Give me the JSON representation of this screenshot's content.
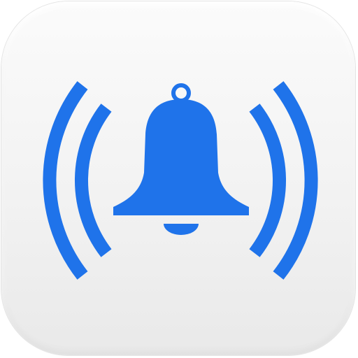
{
  "app_icon": {
    "name": "alarm-bell-app-icon",
    "glyph": "ringing-bell-icon",
    "colors": {
      "glyph": "#1f73ea",
      "background_top": "#fbfbfb",
      "background_bottom": "#e9e9e9"
    }
  }
}
